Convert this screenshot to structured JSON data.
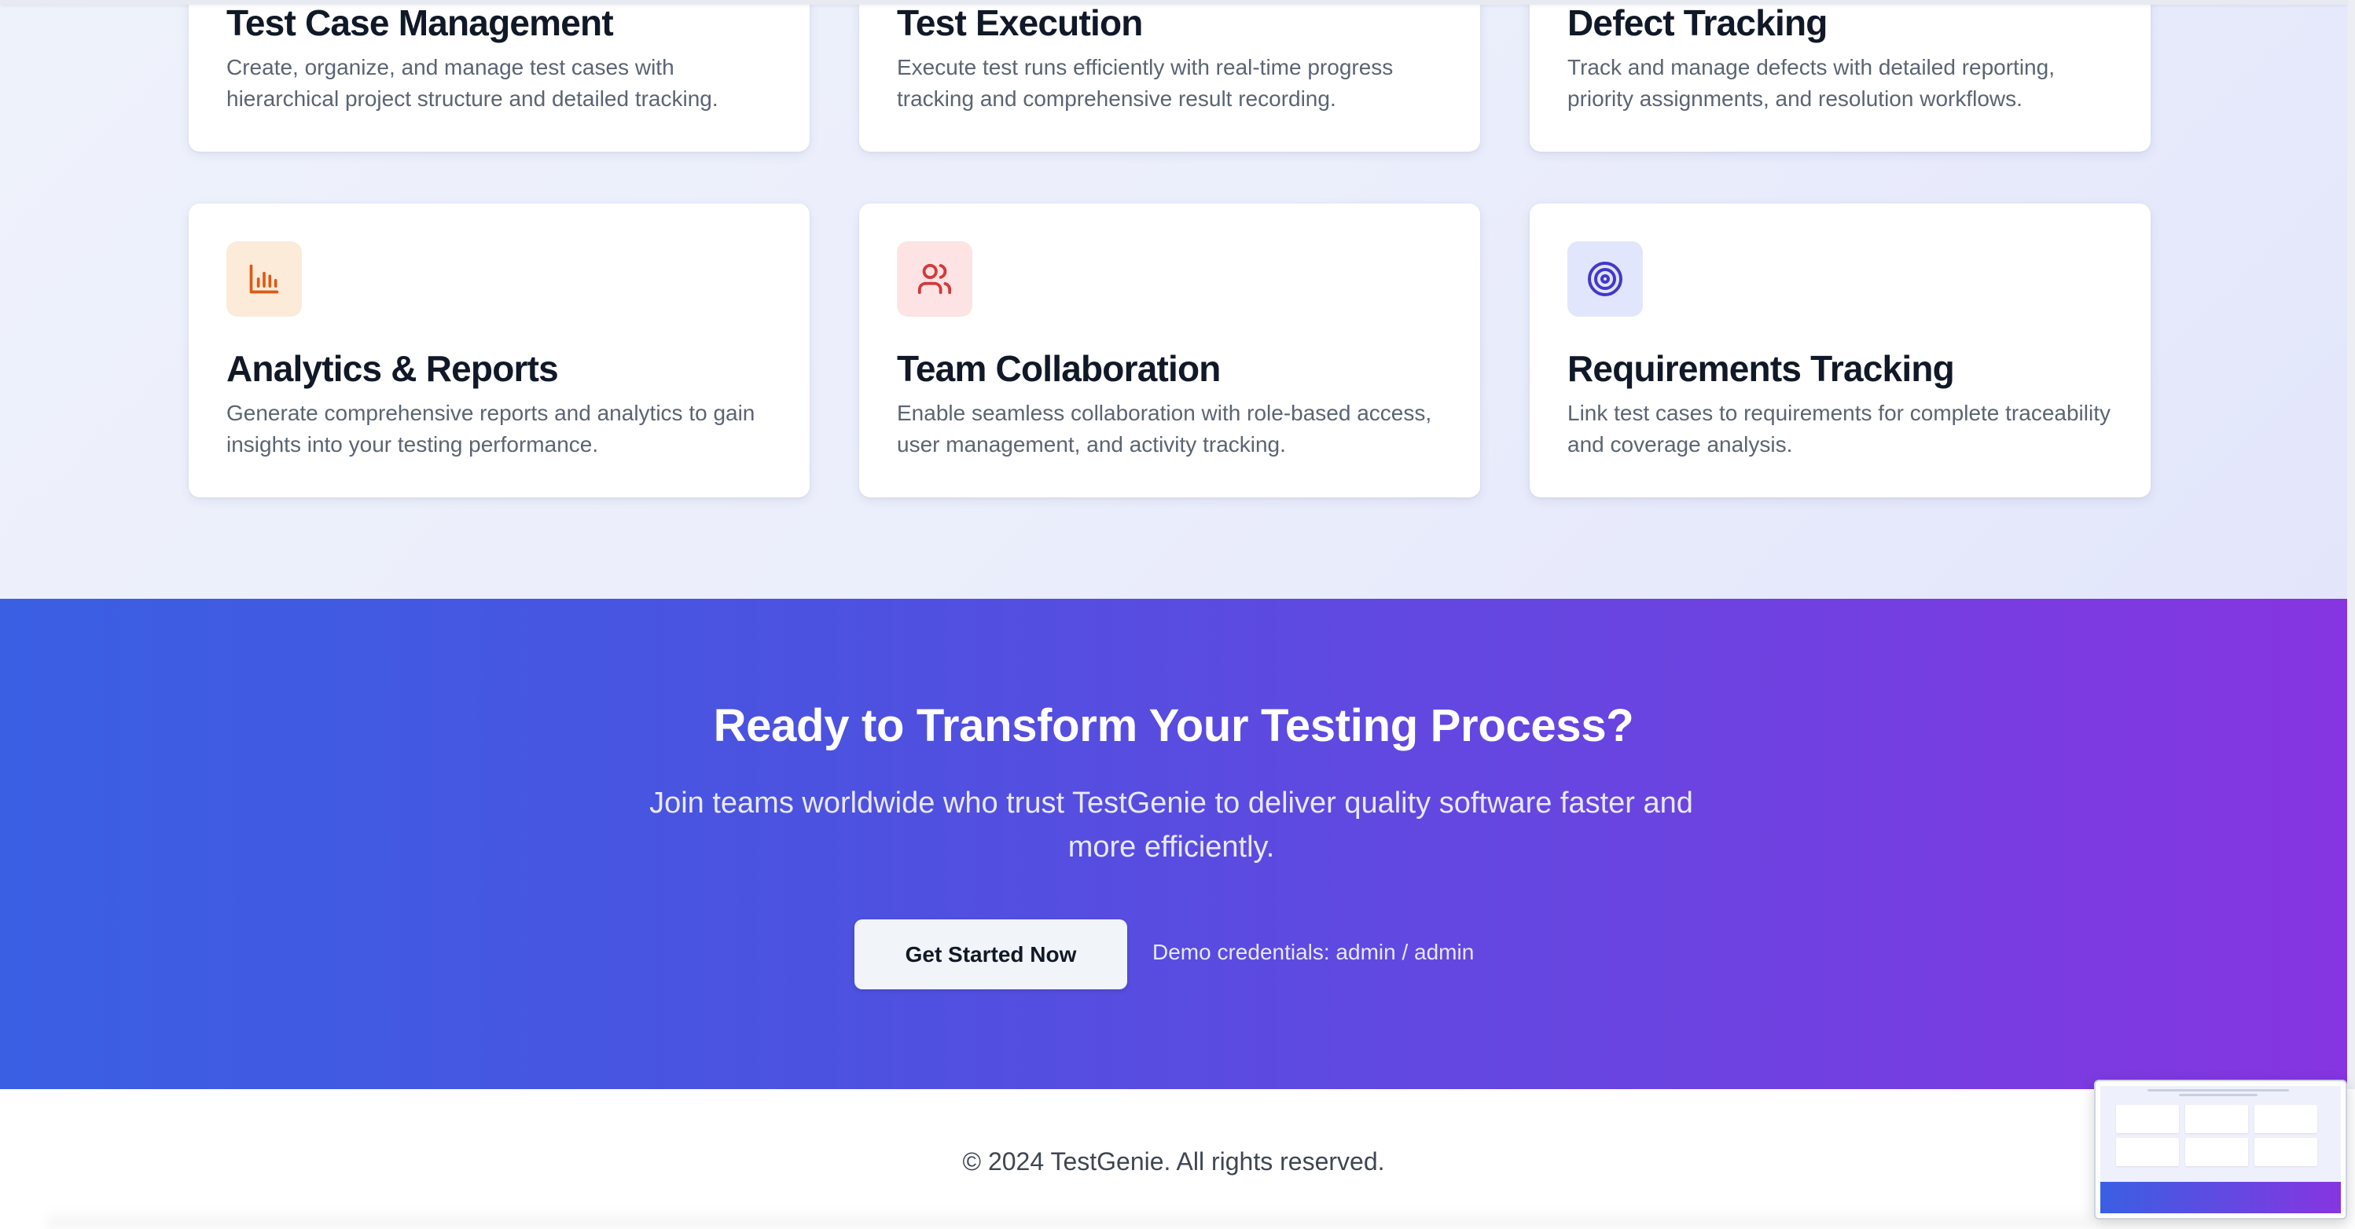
{
  "features": [
    {
      "title": "Test Case Management",
      "description": "Create, organize, and manage test cases with hierarchical project structure and detailed tracking."
    },
    {
      "title": "Test Execution",
      "description": "Execute test runs efficiently with real-time progress tracking and comprehensive result recording."
    },
    {
      "title": "Defect Tracking",
      "description": "Track and manage defects with detailed reporting, priority assignments, and resolution workflows."
    },
    {
      "title": "Analytics & Reports",
      "description": "Generate comprehensive reports and analytics to gain insights into your testing performance.",
      "icon": "bar-chart-icon",
      "icon_bg": "#fdebd9",
      "icon_color": "#dd5a12"
    },
    {
      "title": "Team Collaboration",
      "description": "Enable seamless collaboration with role-based access, user management, and activity tracking.",
      "icon": "users-icon",
      "icon_bg": "#fde3e3",
      "icon_color": "#d23a3a"
    },
    {
      "title": "Requirements Tracking",
      "description": "Link test cases to requirements for complete traceability and coverage analysis.",
      "icon": "target-icon",
      "icon_bg": "#e2e6fd",
      "icon_color": "#4338ca"
    }
  ],
  "cta": {
    "title": "Ready to Transform Your Testing Process?",
    "subtitle": "Join teams worldwide who trust TestGenie to deliver quality software faster and more efficiently.",
    "button_label": "Get Started Now",
    "demo_text": "Demo credentials: admin / admin",
    "gradient_start": "#3a5fe3",
    "gradient_end": "#8635e0"
  },
  "footer": {
    "copyright": "© 2024 TestGenie. All rights reserved."
  }
}
